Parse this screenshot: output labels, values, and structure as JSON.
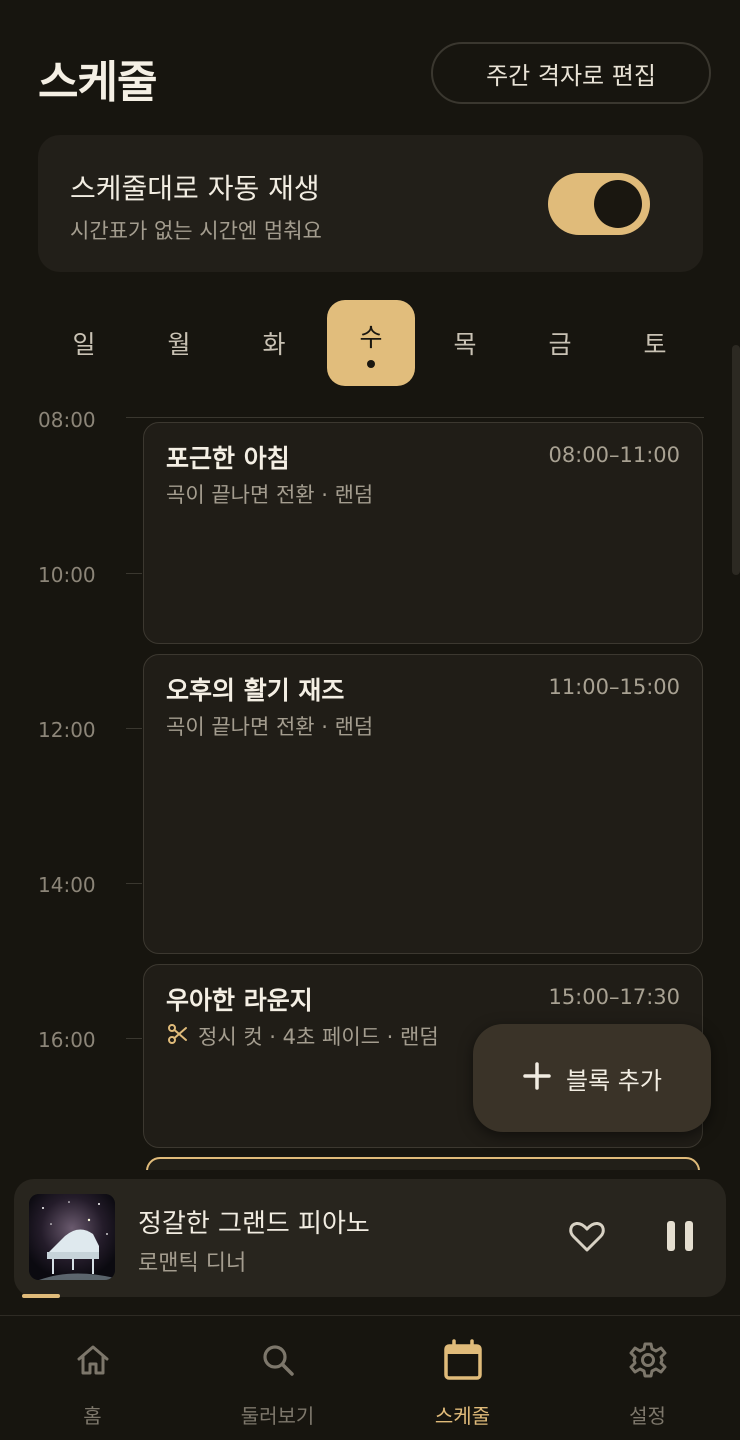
{
  "header": {
    "title": "스케줄",
    "edit_button": "주간 격자로 편집"
  },
  "auto_play": {
    "title": "스케줄대로 자동 재생",
    "subtitle": "시간표가 없는 시간엔 멈춰요",
    "enabled": true
  },
  "days": [
    {
      "label": "일",
      "active": false
    },
    {
      "label": "월",
      "active": false
    },
    {
      "label": "화",
      "active": false
    },
    {
      "label": "수",
      "active": true
    },
    {
      "label": "목",
      "active": false
    },
    {
      "label": "금",
      "active": false
    },
    {
      "label": "토",
      "active": false
    }
  ],
  "timeline": {
    "hours": [
      "08:00",
      "10:00",
      "12:00",
      "14:00",
      "16:00"
    ],
    "blocks": [
      {
        "title": "포근한 아침",
        "time": "08:00–11:00",
        "meta": "곡이 끝나면 전환 · 랜덤",
        "icon": ""
      },
      {
        "title": "오후의 활기 재즈",
        "time": "11:00–15:00",
        "meta": "곡이 끝나면 전환 · 랜덤",
        "icon": ""
      },
      {
        "title": "우아한 라운지",
        "time": "15:00–17:30",
        "meta": "정시 컷 · 4초 페이드 · 랜덤",
        "icon": "scissors-icon"
      }
    ]
  },
  "fab": {
    "label": "블록 추가",
    "icon": "plus-icon"
  },
  "player": {
    "title": "정갈한 그랜드 피아노",
    "subtitle": "로맨틱 디너",
    "progress": 0.05
  },
  "nav": {
    "items": [
      {
        "label": "홈",
        "icon": "home-icon",
        "active": false
      },
      {
        "label": "둘러보기",
        "icon": "search-icon",
        "active": false
      },
      {
        "label": "스케줄",
        "icon": "calendar-icon",
        "active": true
      },
      {
        "label": "설정",
        "icon": "gear-icon",
        "active": false
      }
    ]
  },
  "colors": {
    "background": "#17150f",
    "accent": "#e0bb7a",
    "card": "#221f19",
    "muted_text": "#a49d8f"
  }
}
